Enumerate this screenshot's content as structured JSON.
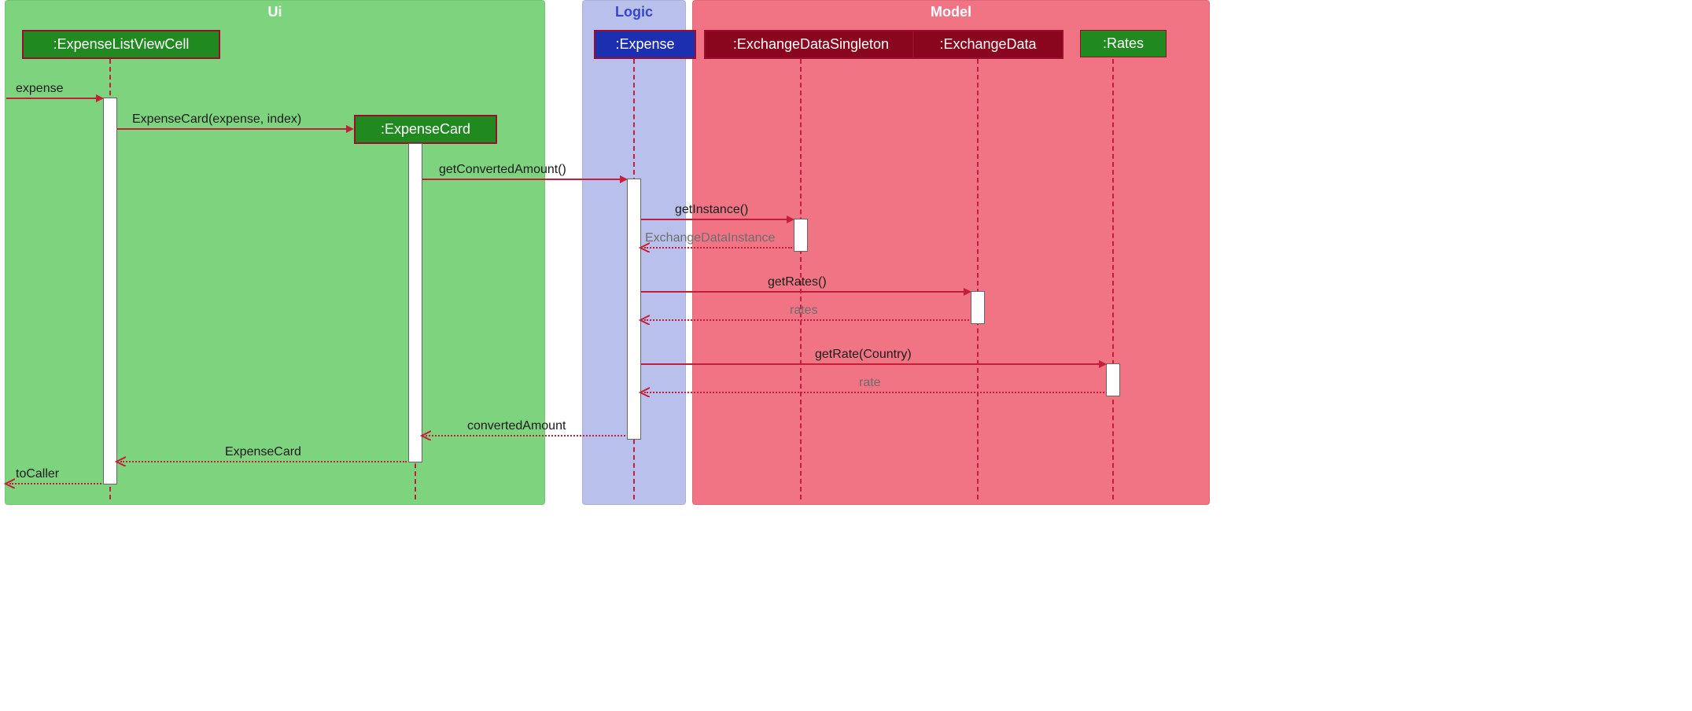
{
  "partitions": {
    "ui": {
      "title": "Ui"
    },
    "logic": {
      "title": "Logic"
    },
    "model": {
      "title": "Model"
    }
  },
  "lifelines": {
    "expenseListViewCell": ":ExpenseListViewCell",
    "expenseCard": ":ExpenseCard",
    "expense": ":Expense",
    "exchangeDataSingleton": ":ExchangeDataSingleton",
    "exchangeData": ":ExchangeData",
    "rates": ":Rates"
  },
  "messages": {
    "m1": "expense",
    "m2": "ExpenseCard(expense, index)",
    "m3": "getConvertedAmount()",
    "m4": "getInstance()",
    "m5": "ExchangeDataInstance",
    "m6": "getRates()",
    "m7": "rates",
    "m8": "getRate(Country)",
    "m9": "rate",
    "m10": "convertedAmount",
    "m11": "ExpenseCard",
    "m12": "toCaller"
  },
  "chart_data": {
    "type": "table",
    "title": "UML Sequence Diagram",
    "partitions": [
      "Ui",
      "Logic",
      "Model"
    ],
    "lifelines": [
      {
        "name": ":ExpenseListViewCell",
        "partition": "Ui",
        "created_by_message": null
      },
      {
        "name": ":ExpenseCard",
        "partition": "Ui",
        "created_by_message": "ExpenseCard(expense, index)"
      },
      {
        "name": ":Expense",
        "partition": "Logic",
        "created_by_message": null
      },
      {
        "name": ":ExchangeDataSingleton",
        "partition": "Model",
        "created_by_message": null
      },
      {
        "name": ":ExchangeData",
        "partition": "Model",
        "created_by_message": null
      },
      {
        "name": ":Rates",
        "partition": "Model",
        "created_by_message": null
      }
    ],
    "interactions": [
      {
        "from": "caller",
        "to": ":ExpenseListViewCell",
        "label": "expense",
        "type": "sync"
      },
      {
        "from": ":ExpenseListViewCell",
        "to": ":ExpenseCard",
        "label": "ExpenseCard(expense, index)",
        "type": "create"
      },
      {
        "from": ":ExpenseCard",
        "to": ":Expense",
        "label": "getConvertedAmount()",
        "type": "sync"
      },
      {
        "from": ":Expense",
        "to": ":ExchangeDataSingleton",
        "label": "getInstance()",
        "type": "sync"
      },
      {
        "from": ":ExchangeDataSingleton",
        "to": ":Expense",
        "label": "ExchangeDataInstance",
        "type": "return"
      },
      {
        "from": ":Expense",
        "to": ":ExchangeData",
        "label": "getRates()",
        "type": "sync"
      },
      {
        "from": ":ExchangeData",
        "to": ":Expense",
        "label": "rates",
        "type": "return"
      },
      {
        "from": ":Expense",
        "to": ":Rates",
        "label": "getRate(Country)",
        "type": "sync"
      },
      {
        "from": ":Rates",
        "to": ":Expense",
        "label": "rate",
        "type": "return"
      },
      {
        "from": ":Expense",
        "to": ":ExpenseCard",
        "label": "convertedAmount",
        "type": "return"
      },
      {
        "from": ":ExpenseCard",
        "to": ":ExpenseListViewCell",
        "label": "ExpenseCard",
        "type": "return"
      },
      {
        "from": ":ExpenseListViewCell",
        "to": "caller",
        "label": "toCaller",
        "type": "return"
      }
    ]
  }
}
